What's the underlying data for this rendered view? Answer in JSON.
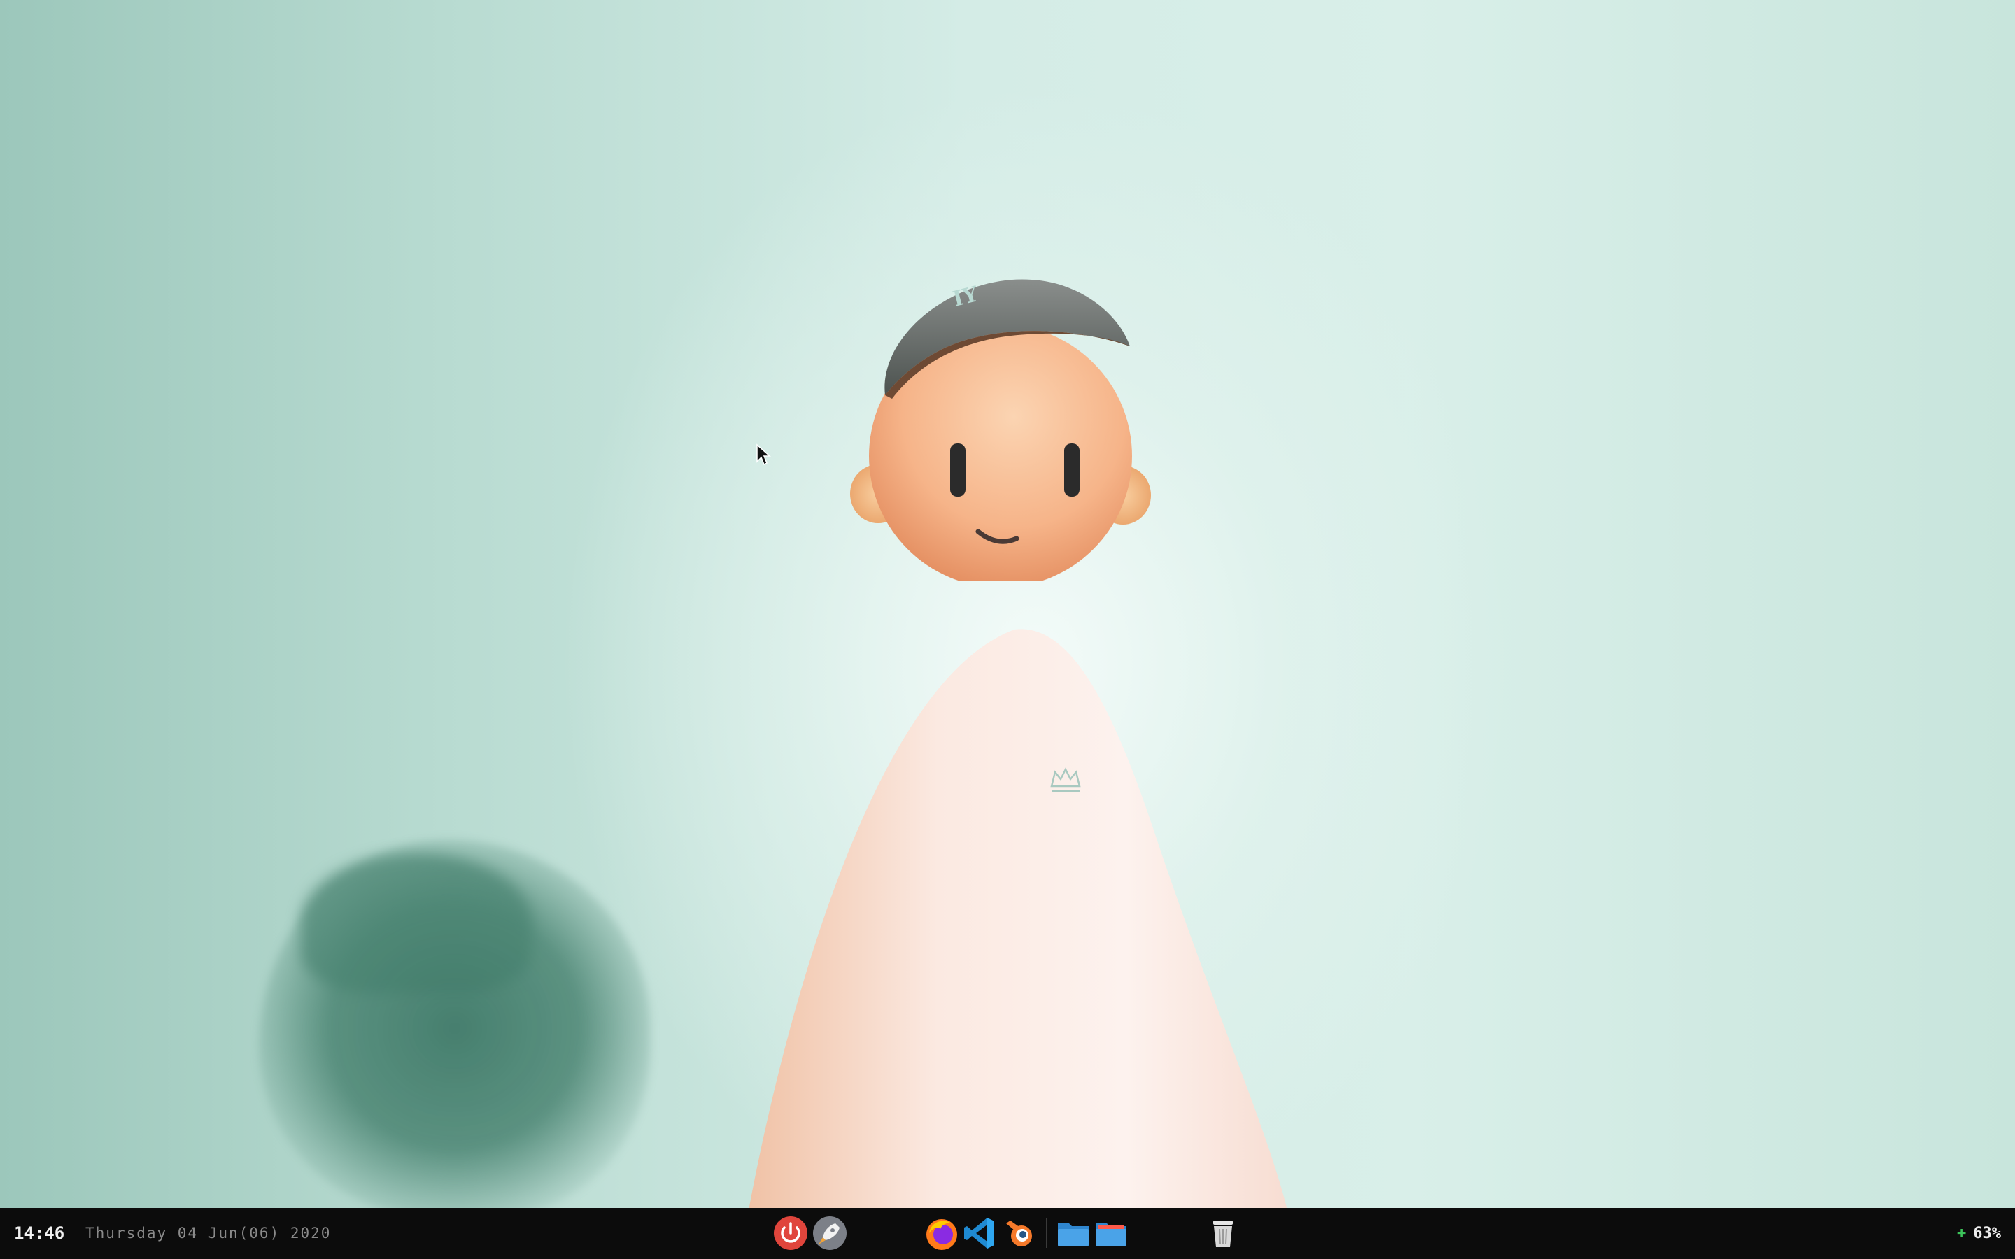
{
  "taskbar": {
    "time": "14:46",
    "date": "Thursday 04 Jun(06) 2020",
    "battery_symbol": "+",
    "battery_percent": "63%"
  },
  "dock": {
    "items": [
      {
        "name": "power",
        "icon": "power-icon",
        "color": "#e0453c"
      },
      {
        "name": "launcher",
        "icon": "rocket-icon",
        "color": "#7c8088"
      },
      {
        "name": "firefox",
        "icon": "firefox-icon",
        "color": "#ff7a1a"
      },
      {
        "name": "vscode",
        "icon": "vscode-icon",
        "color": "#1f8ad2"
      },
      {
        "name": "blender",
        "icon": "blender-icon",
        "color": "#f5792a"
      },
      {
        "name": "files",
        "icon": "folder-icon",
        "color": "#4aa3e8"
      },
      {
        "name": "files-2",
        "icon": "folder-icon",
        "color": "#4aa3e8"
      },
      {
        "name": "trash",
        "icon": "trash-icon",
        "color": "#d8d8d8"
      }
    ]
  },
  "colors": {
    "taskbar_bg": "#0c0c0c",
    "wallpaper_main": "#d4ece6",
    "battery_plus": "#3cc35a"
  }
}
